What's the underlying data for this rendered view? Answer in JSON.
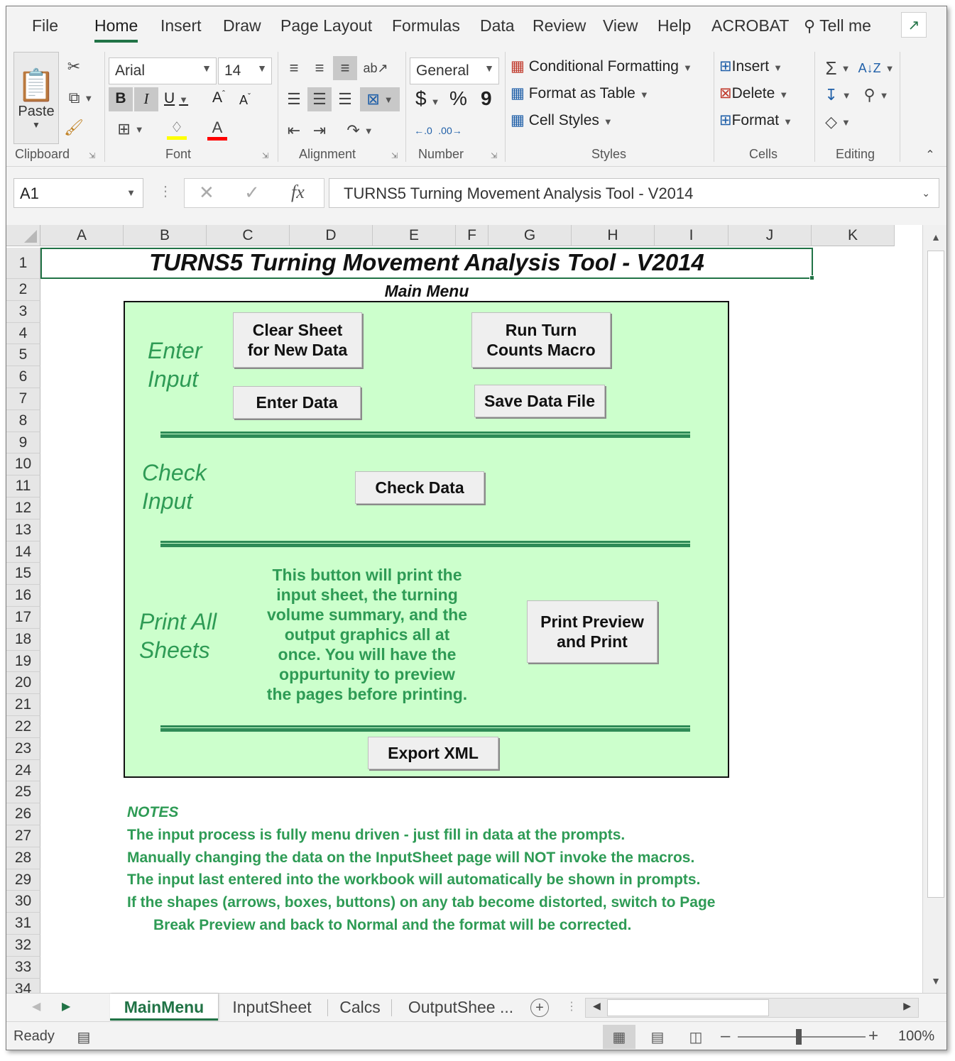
{
  "ribbon_tabs": [
    "File",
    "Home",
    "Insert",
    "Draw",
    "Page Layout",
    "Formulas",
    "Data",
    "Review",
    "View",
    "Help",
    "ACROBAT",
    "Tell me"
  ],
  "ribbon": {
    "clipboard": {
      "paste": "Paste",
      "label": "Clipboard"
    },
    "font": {
      "name": "Arial",
      "size": "14",
      "bold": "B",
      "italic": "I",
      "underline": "U",
      "grow": "A",
      "shrink": "A",
      "color_letter": "A",
      "label": "Font"
    },
    "alignment": {
      "label": "Alignment"
    },
    "number": {
      "format": "General",
      "currency": "$",
      "percent": "%",
      "comma": "9",
      "label": "Number"
    },
    "styles": {
      "conditional": "Conditional Formatting",
      "table": "Format as Table",
      "cell": "Cell Styles",
      "label": "Styles"
    },
    "cells": {
      "insert": "Insert",
      "delete": "Delete",
      "format": "Format",
      "label": "Cells"
    },
    "editing": {
      "label": "Editing"
    }
  },
  "formula_bar": {
    "name_box": "A1",
    "fx": "fx",
    "content": "TURNS5 Turning Movement Analysis Tool - V2014"
  },
  "columns": [
    "A",
    "B",
    "C",
    "D",
    "E",
    "F",
    "G",
    "H",
    "I",
    "J",
    "K"
  ],
  "rows": [
    "1",
    "2",
    "3",
    "4",
    "5",
    "6",
    "7",
    "8",
    "9",
    "10",
    "11",
    "12",
    "13",
    "14",
    "15",
    "16",
    "17",
    "18",
    "19",
    "20",
    "21",
    "22",
    "23",
    "24",
    "25",
    "26",
    "27",
    "28",
    "29",
    "30",
    "31",
    "32",
    "33",
    "34"
  ],
  "sheet": {
    "title": "TURNS5 Turning Movement Analysis Tool - V2014",
    "subtitle": "Main Menu",
    "sections": {
      "enter": "Enter\nInput",
      "check": "Check\nInput",
      "print": "Print All\nSheets"
    },
    "buttons": {
      "clear": "Clear Sheet\nfor New Data",
      "run": "Run Turn\nCounts Macro",
      "enter": "Enter Data",
      "save": "Save Data File",
      "check": "Check Data",
      "print": "Print Preview\nand Print",
      "export": "Export XML"
    },
    "print_description": [
      "This button will print the",
      "input sheet, the turning",
      "volume summary, and the",
      "output graphics all at",
      "once. You will have the",
      "oppurtunity to preview",
      "the pages before printing."
    ],
    "notes": {
      "heading": "NOTES",
      "lines": [
        "The input process is fully menu driven - just fill in data at the prompts.",
        "Manually changing the data on the InputSheet page will NOT invoke the macros.",
        "The input last entered into the workbook will automatically be shown in prompts.",
        "If the shapes (arrows, boxes, buttons) on any tab become distorted, switch to Page",
        "Break Preview and back to Normal and the format will be corrected."
      ]
    }
  },
  "sheet_tabs": [
    "MainMenu",
    "InputSheet",
    "Calcs",
    "OutputShee ..."
  ],
  "status": {
    "text": "Ready",
    "zoom": "100%"
  },
  "colors": {
    "excel_green": "#217346",
    "panel_bg": "#ccffcc",
    "text_green": "#2e9b55",
    "divider": "#2e8b57"
  }
}
